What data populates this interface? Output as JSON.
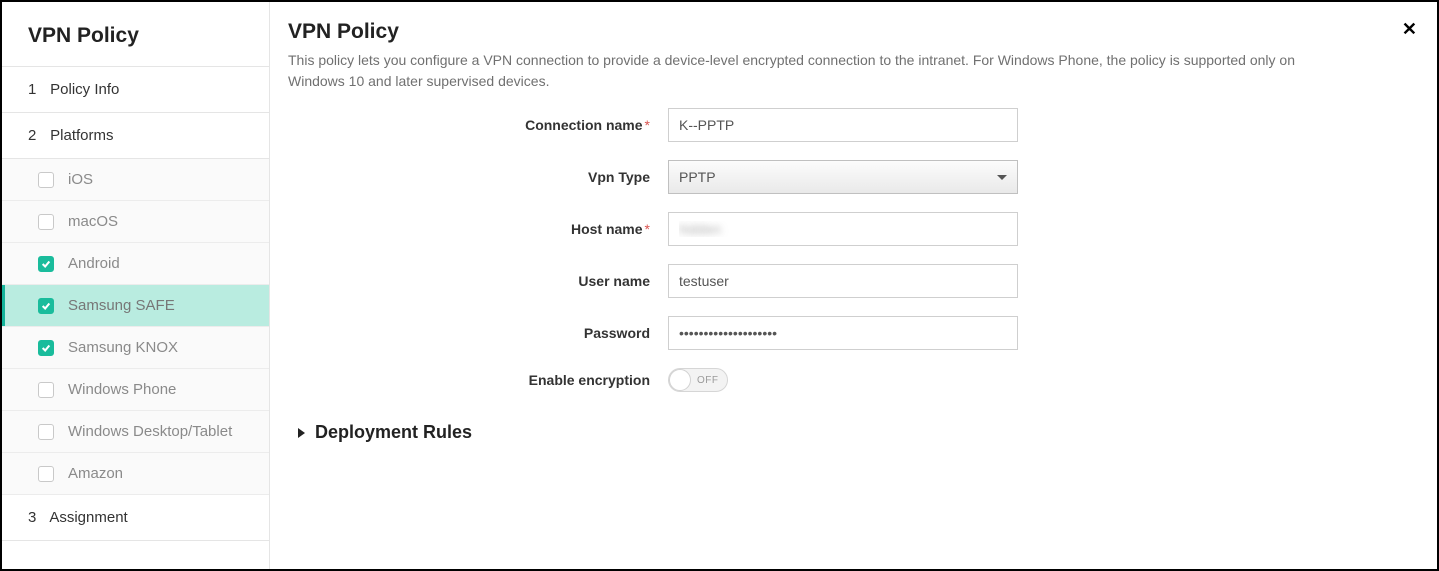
{
  "sidebar": {
    "title": "VPN Policy",
    "steps": {
      "policy_info": {
        "num": "1",
        "label": "Policy Info"
      },
      "platforms": {
        "num": "2",
        "label": "Platforms"
      },
      "assignment": {
        "num": "3",
        "label": "Assignment"
      }
    },
    "platforms": [
      {
        "label": "iOS",
        "checked": false,
        "active": false
      },
      {
        "label": "macOS",
        "checked": false,
        "active": false
      },
      {
        "label": "Android",
        "checked": true,
        "active": false
      },
      {
        "label": "Samsung SAFE",
        "checked": true,
        "active": true
      },
      {
        "label": "Samsung KNOX",
        "checked": true,
        "active": false
      },
      {
        "label": "Windows Phone",
        "checked": false,
        "active": false
      },
      {
        "label": "Windows Desktop/Tablet",
        "checked": false,
        "active": false
      },
      {
        "label": "Amazon",
        "checked": false,
        "active": false
      }
    ]
  },
  "main": {
    "title": "VPN Policy",
    "description": "This policy lets you configure a VPN connection to provide a device-level encrypted connection to the intranet. For Windows Phone, the policy is supported only on Windows 10 and later supervised devices.",
    "fields": {
      "connection_name": {
        "label": "Connection name",
        "value": "K--PPTP",
        "required": true
      },
      "vpn_type": {
        "label": "Vpn Type",
        "value": "PPTP"
      },
      "host_name": {
        "label": "Host name",
        "value": "hidden",
        "required": true
      },
      "user_name": {
        "label": "User name",
        "value": "testuser"
      },
      "password": {
        "label": "Password",
        "value": "••••••••••••••••••••"
      },
      "enable_encryption": {
        "label": "Enable encryption",
        "value": "OFF"
      }
    },
    "deployment_rules_title": "Deployment Rules"
  }
}
